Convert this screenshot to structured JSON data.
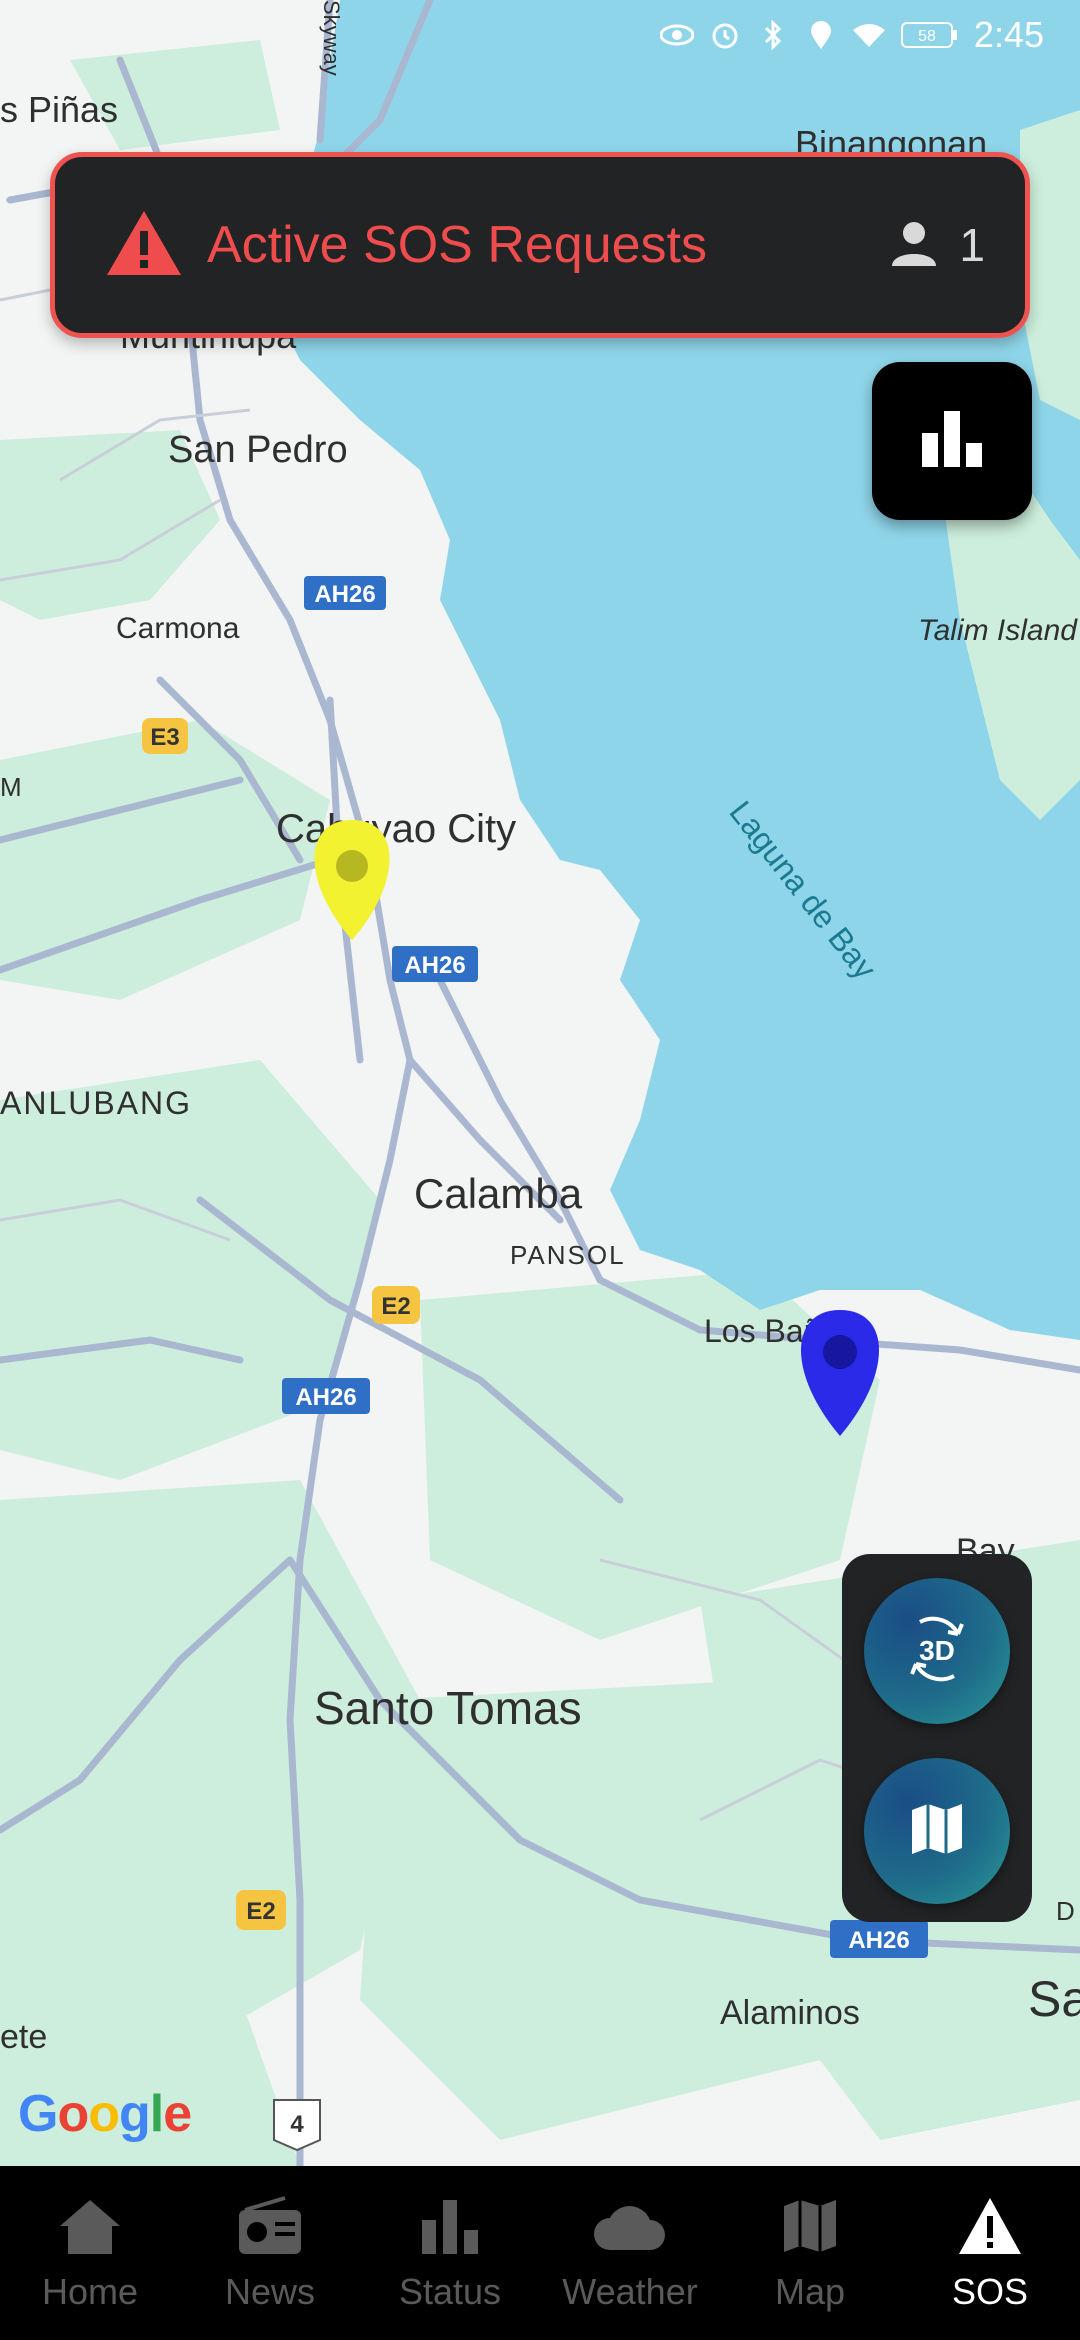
{
  "status_bar": {
    "time": "2:45",
    "battery": "58"
  },
  "sos_banner": {
    "title": "Active SOS Requests",
    "count": "1"
  },
  "map": {
    "places": {
      "las_pinas": "s Piñas",
      "binangonan": "Binangonan",
      "muntinlupa": "Muntinlupa",
      "san_pedro": "San Pedro",
      "carmona": "Carmona",
      "talim": "Talim Island",
      "cabuyao": "Cabuyao City",
      "laguna_de_bay": "Laguna de Bay",
      "lanlubang": "ANLUBANG",
      "calamba": "Calamba",
      "pansol": "PANSOL",
      "los_banos": "Los Baños",
      "bay": "Bay",
      "santo_tomas": "Santo Tomas",
      "alaminos": "Alaminos",
      "sa": "Sa",
      "ete": "ete",
      "skyway": "Skyway",
      "m": "M",
      "d": "D"
    },
    "shields": {
      "ah26": "AH26",
      "e3": "E3",
      "e2": "E2",
      "route4": "4"
    },
    "attribution": "Google",
    "markers": [
      {
        "name": "yellow-marker",
        "color": "#f2f230"
      },
      {
        "name": "blue-marker",
        "color": "#2a2ae8"
      }
    ]
  },
  "controls": {
    "btn_3d_label": "3D"
  },
  "nav": {
    "items": [
      {
        "label": "Home",
        "icon": "home-icon"
      },
      {
        "label": "News",
        "icon": "radio-icon"
      },
      {
        "label": "Status",
        "icon": "bar-chart-icon"
      },
      {
        "label": "Weather",
        "icon": "cloud-icon"
      },
      {
        "label": "Map",
        "icon": "map-icon"
      },
      {
        "label": "SOS",
        "icon": "warning-icon"
      }
    ],
    "active": "SOS"
  },
  "colors": {
    "water": "#8fd5ea",
    "land": "#f3f4f4",
    "park": "#cdeedc",
    "road": "#a9b7d0",
    "sos_red": "#ef4d4d",
    "banner_bg": "#222325"
  }
}
